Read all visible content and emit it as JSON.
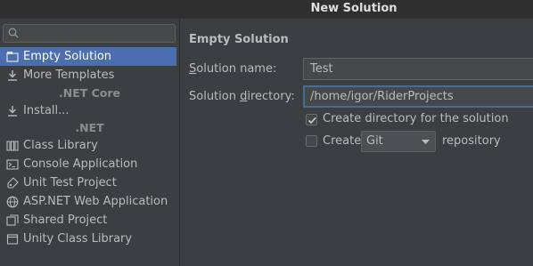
{
  "window": {
    "title": "New Solution"
  },
  "sidebar": {
    "search_placeholder": "",
    "items": [
      {
        "label": "Empty Solution",
        "icon": "empty-solution-icon",
        "selected": true
      },
      {
        "label": "More Templates",
        "icon": "download-icon"
      },
      {
        "group": ".NET Core"
      },
      {
        "label": "Install...",
        "icon": "download-icon"
      },
      {
        "group": ".NET"
      },
      {
        "label": "Class Library",
        "icon": "class-library-icon"
      },
      {
        "label": "Console Application",
        "icon": "console-icon"
      },
      {
        "label": "Unit Test Project",
        "icon": "unit-test-icon"
      },
      {
        "label": "ASP.NET Web Application",
        "icon": "globe-icon"
      },
      {
        "label": "Shared Project",
        "icon": "shared-project-icon"
      },
      {
        "label": "Unity Class Library",
        "icon": "unity-icon"
      }
    ]
  },
  "main": {
    "heading": "Empty Solution",
    "solution_name_label_pre": "",
    "solution_name_label_ul": "S",
    "solution_name_label_post": "olution name:",
    "solution_name_value": "Test",
    "solution_dir_label_pre": "Solution ",
    "solution_dir_label_ul": "d",
    "solution_dir_label_post": "irectory:",
    "solution_dir_value": "/home/igor/RiderProjects",
    "create_dir_label": "Create directory for the solution",
    "create_dir_checked": true,
    "create_repo_label": "Create",
    "create_repo_checked": false,
    "vcs_selected": "Git",
    "repository_label": "repository"
  },
  "colors": {
    "accent": "#4b6eaf",
    "background": "#3c3f41",
    "titlebar": "#2f2f2f"
  }
}
